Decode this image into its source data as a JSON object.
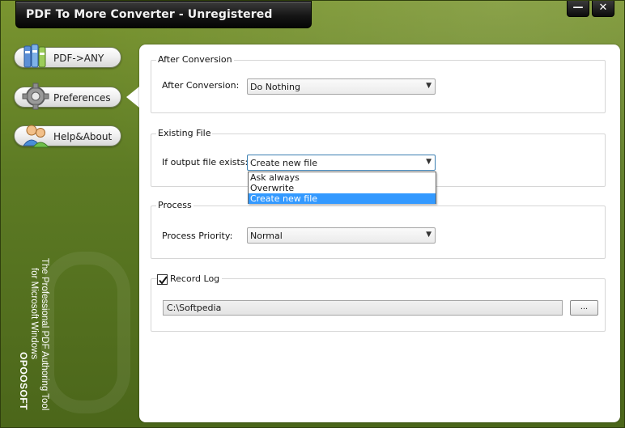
{
  "window": {
    "title": "PDF To More Converter - Unregistered",
    "minimize_glyph": "—",
    "close_glyph": "✕"
  },
  "sidebar": {
    "items": [
      {
        "label": "PDF->ANY",
        "icon": "books-icon"
      },
      {
        "label": "Preferences",
        "icon": "gear-icon",
        "active": true
      },
      {
        "label": "Help&About",
        "icon": "users-icon"
      }
    ],
    "branding": {
      "name": "OPOOSOFT",
      "tagline_1": "The Professional PDF Authoring Tool",
      "tagline_2": "for Microsoft Windows"
    }
  },
  "after_conversion": {
    "group_title": "After Conversion",
    "label": "After Conversion:",
    "value": "Do Nothing"
  },
  "existing_file": {
    "group_title": "Existing File",
    "label": "If output file exists:",
    "value": "Create new file",
    "options": [
      "Ask always",
      "Overwrite",
      "Create new file"
    ],
    "selected_index": 2
  },
  "process": {
    "group_title": "Process",
    "label": "Process Priority:",
    "value": "Normal"
  },
  "record_log": {
    "label": "Record Log",
    "checked": true,
    "path": "C:\\Softpedia",
    "browse_label": "..."
  },
  "colors": {
    "background_green": "#5d7b24",
    "selection_blue": "#3399ff"
  }
}
